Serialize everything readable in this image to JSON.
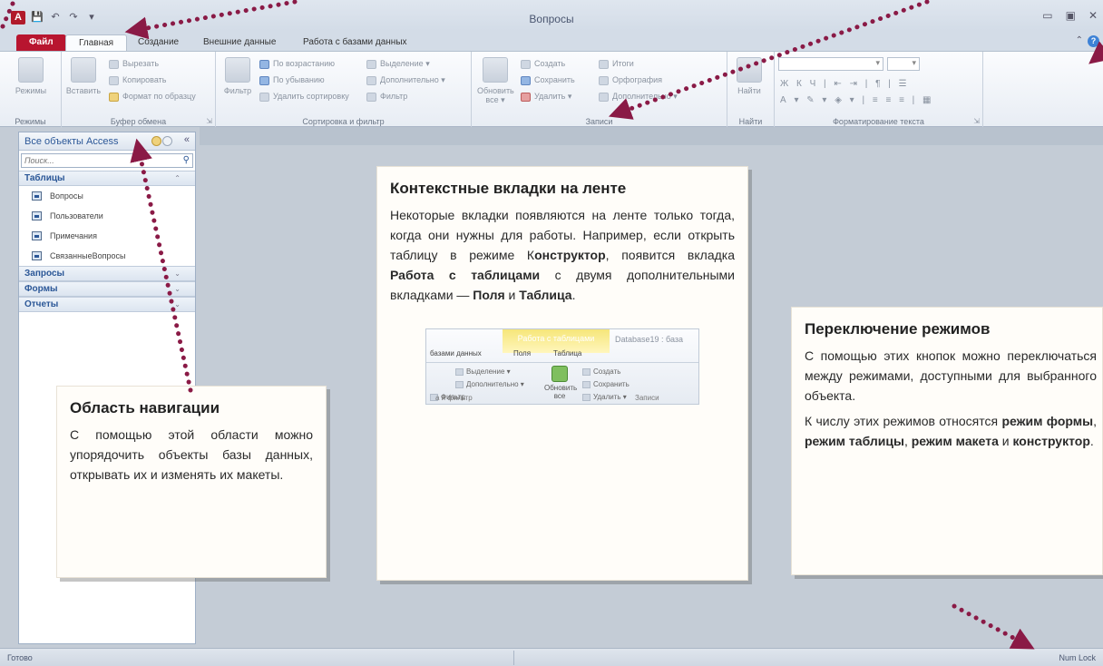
{
  "window": {
    "title": "Вопросы",
    "app_icon": "A",
    "qat": [
      "💾",
      "↶",
      "↷",
      "▾"
    ],
    "controls": [
      "▭",
      "▣",
      "✕"
    ]
  },
  "tabs": [
    {
      "label": "Файл"
    },
    {
      "label": "Главная"
    },
    {
      "label": "Создание"
    },
    {
      "label": "Внешние данные"
    },
    {
      "label": "Работа с базами данных"
    }
  ],
  "ribbon": {
    "views": {
      "btn": "Режимы",
      "group": "Режимы"
    },
    "clipboard": {
      "paste": "Вставить",
      "cut": "Вырезать",
      "copy": "Копировать",
      "format_painter": "Формат по образцу",
      "group": "Буфер обмена"
    },
    "sort": {
      "filter": "Фильтр",
      "asc": "По возрастанию",
      "desc": "По убыванию",
      "remove": "Удалить сортировку",
      "selection": "Выделение",
      "advanced": "Дополнительно",
      "toggle": "Фильтр",
      "group": "Сортировка и фильтр"
    },
    "records": {
      "refresh": "Обновить все",
      "new": "Создать",
      "save": "Сохранить",
      "delete": "Удалить",
      "totals": "Итоги",
      "spelling": "Орфография",
      "more": "Дополнительно",
      "group": "Записи"
    },
    "find": {
      "btn": "Найти",
      "group": "Найти"
    },
    "text": {
      "group": "Форматирование текста",
      "row1": "Ж  К  Ч  |  ⇤ ⇥  |  ¶  |  ☰",
      "row2": "А ▾  ✎ ▾  ◈ ▾  |  ≡  ≡  ≡  |  ▦"
    }
  },
  "nav": {
    "title": "Все объекты Access",
    "search_placeholder": "Поиск...",
    "groups": [
      {
        "label": "Таблицы",
        "items": [
          "Вопросы",
          "Пользователи",
          "Примечания",
          "СвязанныеВопросы"
        ]
      },
      {
        "label": "Запросы",
        "items": []
      },
      {
        "label": "Формы",
        "items": []
      },
      {
        "label": "Отчеты",
        "items": []
      }
    ]
  },
  "status": {
    "left": "Готово",
    "right": "Num Lock"
  },
  "callouts": {
    "nav": {
      "title": "Область навигации",
      "text": "С помощью этой области можно упорядочить объекты базы данных, открывать их и изменять их макеты."
    },
    "tabs": {
      "title": "Контекстные вкладки на ленте",
      "text_1": "Некоторые вкладки появляются на ленте только тогда, когда они нужны для работы. Например, если открыть таблицу в режиме К",
      "bold_1": "онструктор",
      "text_2": ", появится вкладка ",
      "bold_2": "Работа с таблицами",
      "text_3": " с двумя дополнительными вкладками — ",
      "bold_3": "Поля",
      "text_4": " и ",
      "bold_4": "Таблица",
      "text_5": ".",
      "image": {
        "context_tab": "Работа с таблицами",
        "db_title": "Database19 : база",
        "tabs": [
          "базами данных",
          "Поля",
          "Таблица"
        ],
        "selection": "Выделение",
        "advanced": "Дополнительно",
        "toggle": "Фильтр",
        "refresh": "Обновить все",
        "new": "Создать",
        "save": "Сохранить",
        "delete": "Удалить",
        "foot_left": "а и фильтр",
        "foot_right": "Записи"
      }
    },
    "modes": {
      "title": "Переключение режимов",
      "text_1": "С помощью этих кнопок можно переключаться между режимами, доступными для выбранного объекта.",
      "text_2": "К числу этих режимов относятся ",
      "bold_1": "режим формы",
      "sep_1": ", ",
      "bold_2": "режим таблицы",
      "sep_2": ", ",
      "bold_3": "режим макета",
      "sep_3": " и ",
      "bold_4": "конструктор",
      "end": "."
    }
  },
  "colors": {
    "arrow": "#8a1a46",
    "file_tab": "#b8152f"
  }
}
